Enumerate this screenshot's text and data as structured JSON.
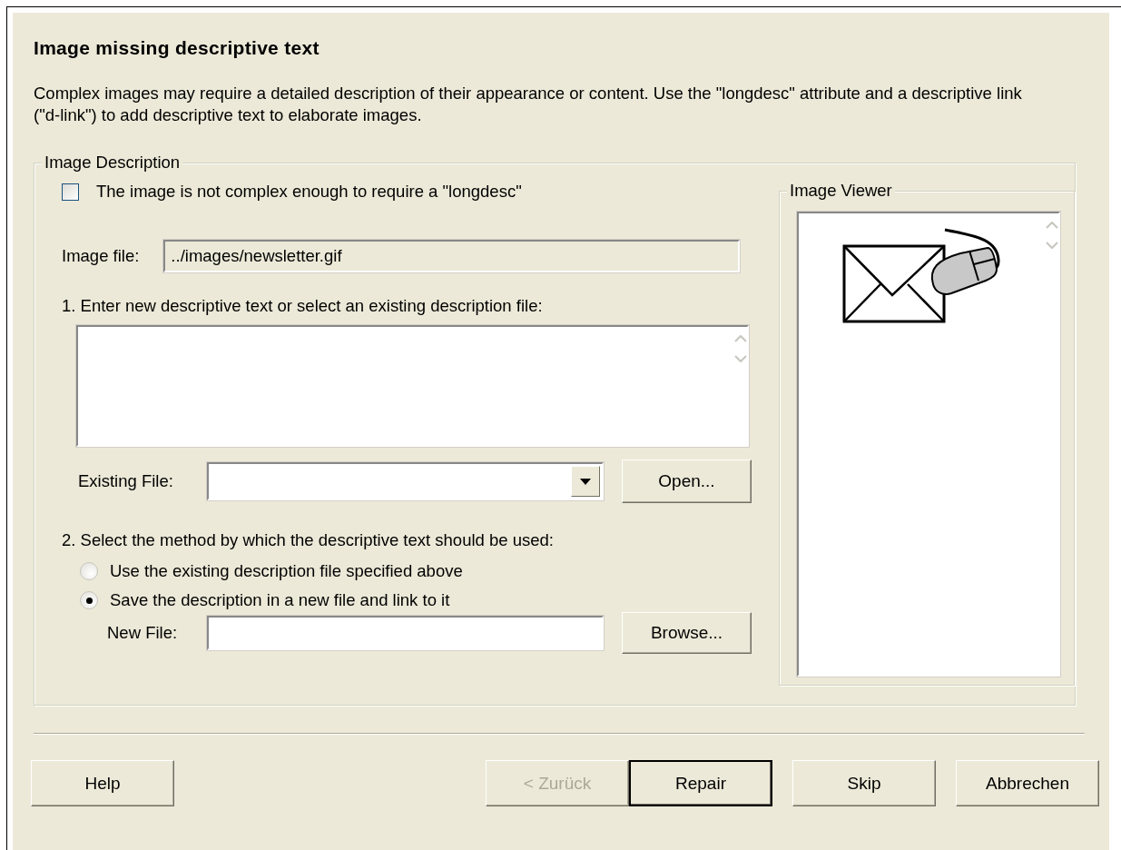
{
  "dialog": {
    "title": "Image missing descriptive text",
    "description": "Complex images may require a detailed description of their appearance or content.  Use the \"longdesc\" attribute and a descriptive link (\"d-link\") to add descriptive text to elaborate images."
  },
  "image_description": {
    "legend": "Image Description",
    "not_complex_checkbox": {
      "label": "The image is not complex enough to require a \"longdesc\"",
      "checked": false
    },
    "image_file": {
      "label": "Image file:",
      "value": "../images/newsletter.gif"
    },
    "step1_label": "1. Enter new descriptive text or select an existing description file:",
    "existing_file": {
      "label": "Existing File:"
    },
    "open_button": "Open...",
    "step2_label": "2. Select the method by which the descriptive text should be used:",
    "methods": [
      {
        "label": "Use the existing description file specified above",
        "selected": false
      },
      {
        "label": "Save the description in a new file and link to it",
        "selected": true
      }
    ],
    "new_file": {
      "label": "New File:"
    },
    "browse_button": "Browse..."
  },
  "image_viewer": {
    "legend": "Image Viewer"
  },
  "buttons": [
    {
      "label": "Help",
      "disabled": false,
      "default": false
    },
    {
      "label": "< Zurück",
      "disabled": true,
      "default": false
    },
    {
      "label": "Repair",
      "disabled": false,
      "default": true
    },
    {
      "label": "Skip",
      "disabled": false,
      "default": false
    },
    {
      "label": "Abbrechen",
      "disabled": false,
      "default": false
    }
  ]
}
